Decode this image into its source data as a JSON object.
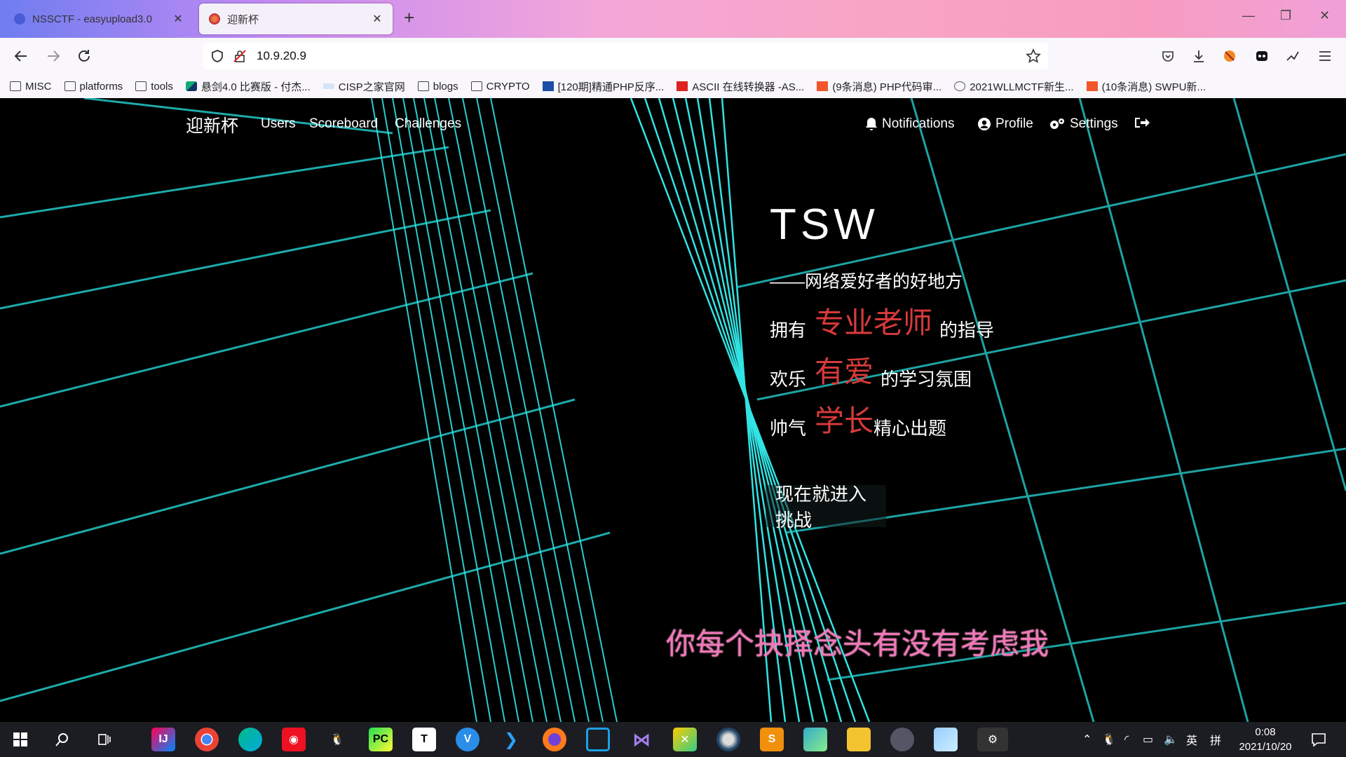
{
  "browser": {
    "tabs": [
      {
        "title": "NSSCTF - easyupload3.0",
        "active": false
      },
      {
        "title": "迎新杯",
        "active": true
      }
    ],
    "new_tab": "+",
    "address": "10.9.20.9",
    "bookmarks": [
      {
        "label": "MISC",
        "icon": "folder-icon"
      },
      {
        "label": "platforms",
        "icon": "folder-icon"
      },
      {
        "label": "tools",
        "icon": "folder-icon"
      },
      {
        "label": "悬剑4.0 比赛版 - 付杰...",
        "icon": "shield-icon"
      },
      {
        "label": "CISP之家官网",
        "icon": "cisp-icon"
      },
      {
        "label": "blogs",
        "icon": "folder-icon"
      },
      {
        "label": "CRYPTO",
        "icon": "folder-icon"
      },
      {
        "label": "[120期]精通PHP反序...",
        "icon": "book-icon"
      },
      {
        "label": "ASCII 在线转换器 -AS...",
        "icon": "calc-icon"
      },
      {
        "label": "(9条消息) PHP代码审...",
        "icon": "csdn-icon"
      },
      {
        "label": "2021WLLMCTF新生...",
        "icon": "globe-icon"
      },
      {
        "label": "(10条消息) SWPU新...",
        "icon": "csdn-icon"
      }
    ]
  },
  "site": {
    "brand": "迎新杯",
    "nav_left": [
      "Users",
      "Scoreboard",
      "Challenges"
    ],
    "nav_right": [
      "Notifications",
      "Profile",
      "Settings"
    ],
    "hero": {
      "title": "TSW",
      "subtitle": "——网络爱好者的好地方",
      "line1": {
        "pre": "拥有",
        "highlight": "专业老师",
        "post": "的指导"
      },
      "line2": {
        "pre": "欢乐",
        "highlight": "有爱",
        "post": "的学习氛围"
      },
      "line3": {
        "pre": "帅气",
        "highlight": "学长",
        "post": "精心出题"
      },
      "button": "现在就进入挑战"
    },
    "lyric": "你每个抉择念头有没有考虑我"
  },
  "taskbar": {
    "time": "0:08",
    "date": "2021/10/20",
    "ime": "英",
    "ime2": "拼"
  },
  "colors": {
    "grid": "#2fe3e3",
    "highlight": "#d83a3a",
    "lyric": "#f178b8"
  }
}
